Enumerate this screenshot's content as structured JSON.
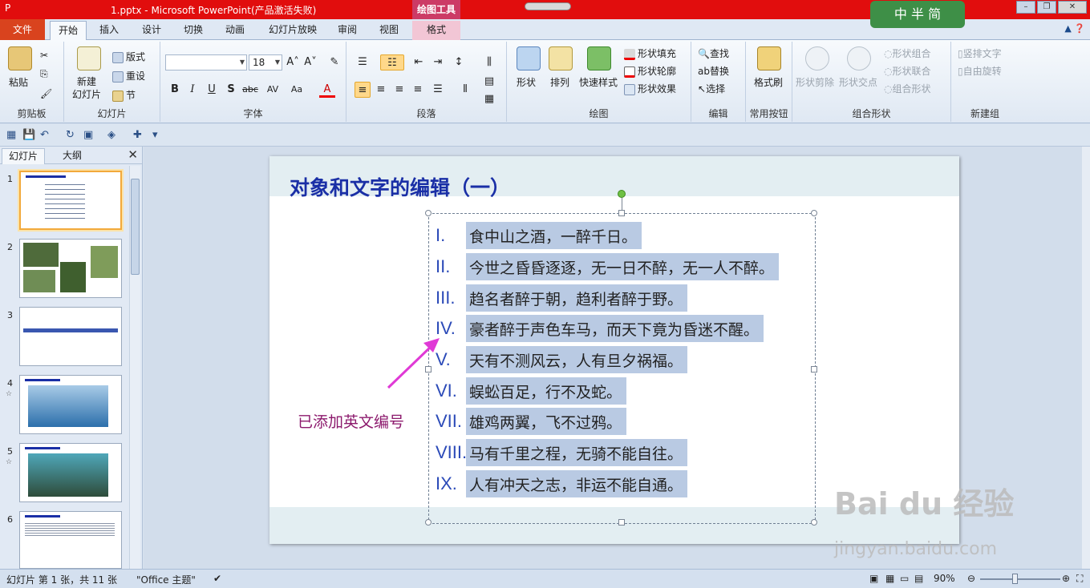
{
  "window": {
    "title": "1.pptx - Microsoft PowerPoint(产品激活失败)",
    "context_tool": "绘图工具",
    "logo_text": "中 半 简"
  },
  "tabs": [
    "文件",
    "开始",
    "插入",
    "设计",
    "切换",
    "动画",
    "幻灯片放映",
    "审阅",
    "视图",
    "格式"
  ],
  "active_tab": "开始",
  "ribbon": {
    "clipboard": {
      "paste": "粘贴",
      "label": "剪贴板"
    },
    "slides": {
      "new_slide": "新建\n幻灯片",
      "layout": "版式",
      "reset": "重设",
      "section": "节",
      "label": "幻灯片"
    },
    "font": {
      "font_size": "18",
      "label": "字体"
    },
    "paragraph": {
      "label": "段落"
    },
    "drawing": {
      "shapes": "形状",
      "arrange": "排列",
      "quick_styles": "快速样式",
      "fill": "形状填充",
      "outline": "形状轮廓",
      "effects": "形状效果",
      "label": "绘图"
    },
    "editing": {
      "find": "查找",
      "replace": "替换",
      "select": "选择",
      "label": "编辑"
    },
    "common": {
      "format_painter": "格式刷",
      "label": "常用按钮"
    },
    "combine": {
      "cut": "形状剪除",
      "intersect": "形状交点",
      "combine": "形状组合",
      "union": "形状联合",
      "group": "组合形状",
      "label": "组合形状"
    },
    "new_group": {
      "vertical_text": "竖排文字",
      "auto_rotate": "自由旋转",
      "label": "新建组"
    }
  },
  "panel": {
    "tab_slides": "幻灯片",
    "tab_outline": "大纲",
    "close": "✕",
    "thumb_numbers": [
      "1",
      "2",
      "3",
      "4",
      "5",
      "6"
    ]
  },
  "slide": {
    "title": "对象和文字的编辑（一）",
    "numbers": [
      "I.",
      "II.",
      "III.",
      "IV.",
      "V.",
      "VI.",
      "VII.",
      "VIII.",
      "IX."
    ],
    "lines": [
      "食中山之酒，一醉千日。",
      "今世之昏昏逐逐，无一日不醉，无一人不醉。",
      "趋名者醉于朝，趋利者醉于野。",
      "豪者醉于声色车马，而天下竟为昏迷不醒。",
      "天有不测风云，人有旦夕祸福。",
      "蜈蚣百足，行不及蛇。",
      "雄鸡两翼，飞不过鸦。",
      "马有千里之程，无骑不能自往。",
      "人有冲天之志，非运不能自通。"
    ],
    "annotation": "已添加英文编号"
  },
  "watermark": {
    "main": "Bai du 经验",
    "sub": "jingyan.baidu.com"
  },
  "status": {
    "slide_info": "幻灯片 第 1 张，共 11 张",
    "theme": "\"Office 主题\"",
    "zoom": "90%"
  }
}
